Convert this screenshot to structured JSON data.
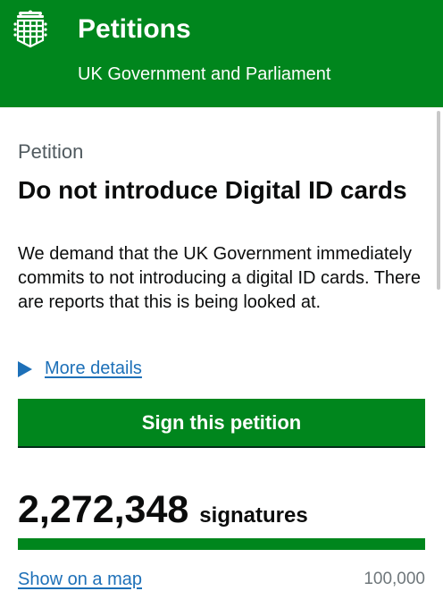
{
  "header": {
    "logo_icon": "portcullis-crest-icon",
    "title": "Petitions",
    "subtitle": "UK Government and Parliament",
    "background_color": "#00861d"
  },
  "petition": {
    "caption": "Petition",
    "title": "Do not introduce Digital ID cards",
    "description": "We demand that the UK Government immediately commits to not introducing a digital ID cards. There are reports that this is being looked at.",
    "details_label": "More details",
    "details_icon": "triangle-right-icon"
  },
  "actions": {
    "sign_label": "Sign this petition"
  },
  "signatures": {
    "count": "2,272,348",
    "label": "signatures",
    "target": "100,000",
    "progress_fraction": 1.0,
    "map_link": "Show on a map"
  },
  "colors": {
    "accent_green": "#00861d",
    "link_blue": "#1d70b8",
    "muted_gray": "#6f777b"
  }
}
